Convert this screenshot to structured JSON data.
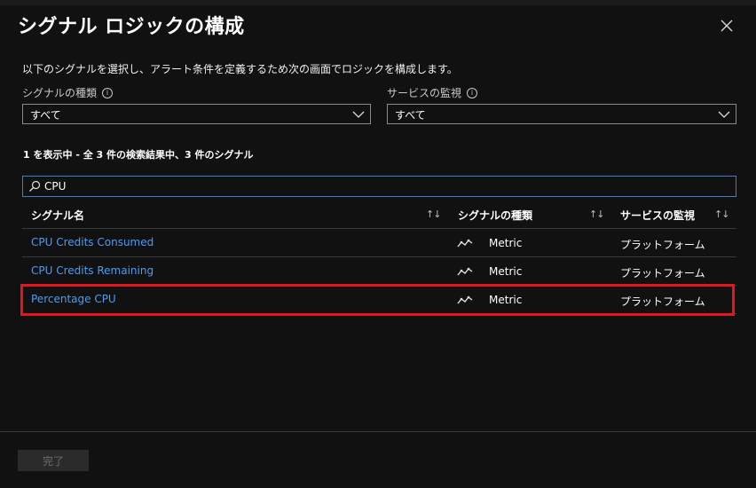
{
  "panel": {
    "title": "シグナル ロジックの構成",
    "description": "以下のシグナルを選択し、アラート条件を定義するため次の画面でロジックを構成します。"
  },
  "filters": {
    "signal_type": {
      "label": "シグナルの種類",
      "value": "すべて"
    },
    "service": {
      "label": "サービスの監視",
      "value": "すべて"
    }
  },
  "results_summary": "1 を表示中 - 全 3 件の検索結果中、3 件のシグナル",
  "search": {
    "value": "CPU"
  },
  "table": {
    "headers": [
      "シグナル名",
      "シグナルの種類",
      "サービスの監視"
    ],
    "sort_glyph": "↑↓",
    "rows": [
      {
        "name": "CPU Credits Consumed",
        "type": "Metric",
        "service": "プラットフォーム"
      },
      {
        "name": "CPU Credits Remaining",
        "type": "Metric",
        "service": "プラットフォーム"
      },
      {
        "name": "Percentage CPU",
        "type": "Metric",
        "service": "プラットフォーム",
        "highlighted": true
      }
    ]
  },
  "footer": {
    "done_label": "完了"
  },
  "colors": {
    "link": "#4c9cf6",
    "highlight": "#e4151c",
    "search_border": "#3b7fd4",
    "background": "#111112"
  },
  "icons": {
    "close": "close-icon",
    "info": "info-icon",
    "chevron": "chevron-down-icon",
    "search": "search-icon",
    "metric": "metric-line-icon"
  }
}
